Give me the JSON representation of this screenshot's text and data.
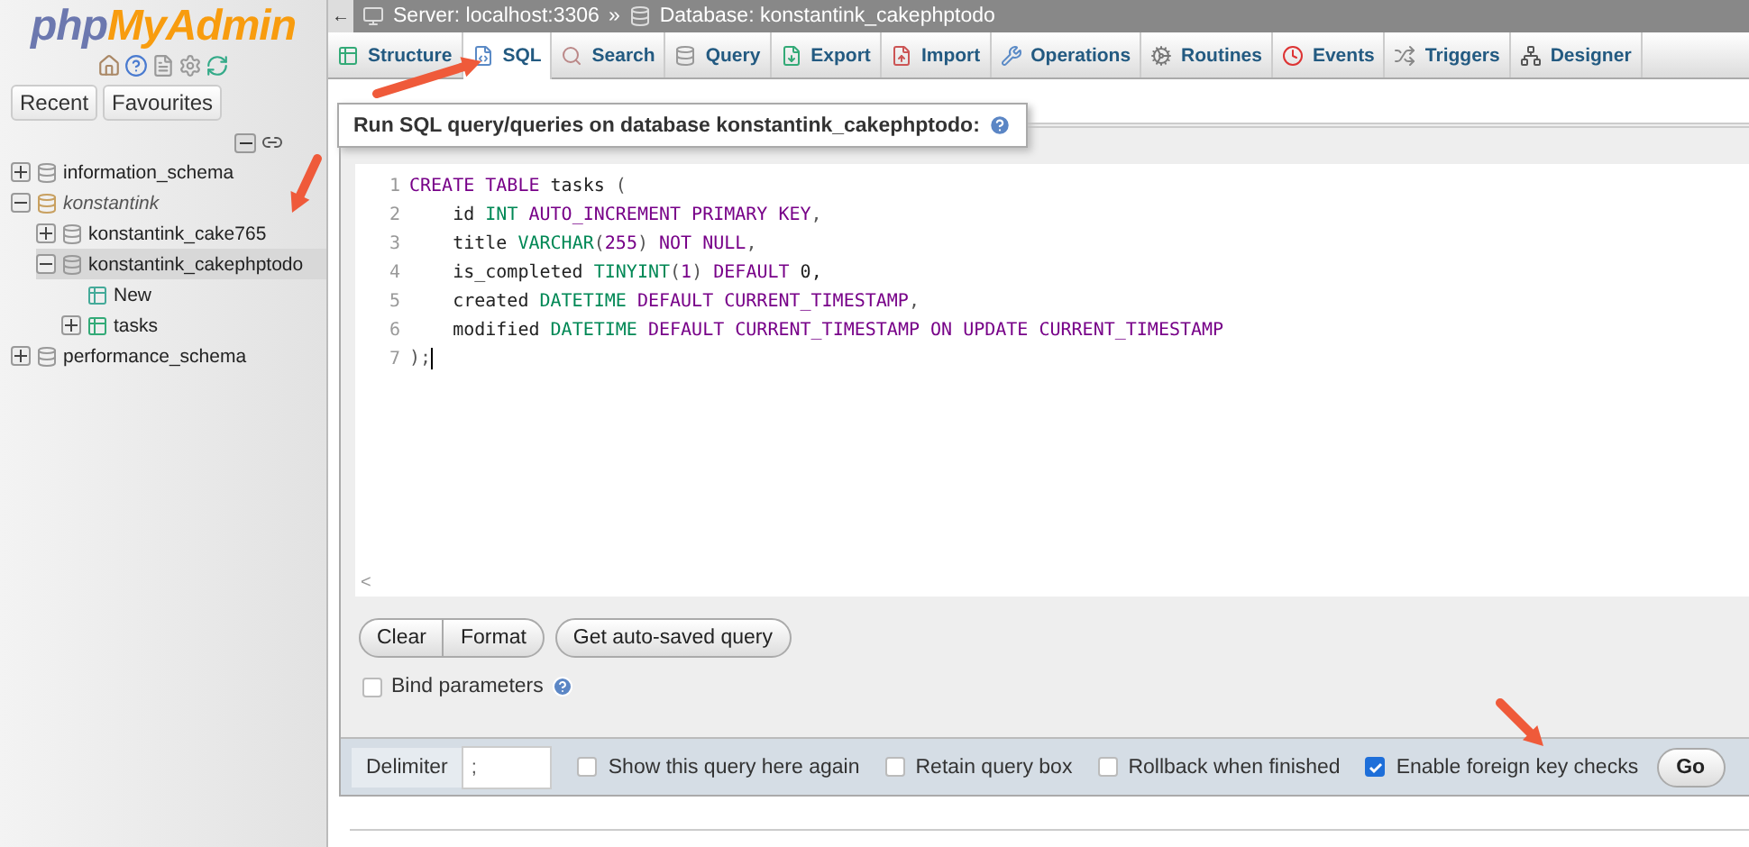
{
  "sidebar": {
    "logo": {
      "prefix": "php",
      "suffix": "MyAdmin"
    },
    "buttons": [
      "Recent",
      "Favourites"
    ],
    "tree": [
      {
        "label": "information_schema",
        "kind": "db",
        "expanded": false,
        "selected": false
      },
      {
        "label": "konstantink",
        "kind": "group",
        "expanded": true,
        "selected": false,
        "children": [
          {
            "label": "konstantink_cake765",
            "kind": "db",
            "expanded": false,
            "selected": false
          },
          {
            "label": "konstantink_cakephptodo",
            "kind": "db",
            "expanded": true,
            "selected": true,
            "children": [
              {
                "label": "New",
                "kind": "new",
                "selected": false
              },
              {
                "label": "tasks",
                "kind": "table",
                "expanded": false,
                "selected": false
              }
            ]
          }
        ]
      },
      {
        "label": "performance_schema",
        "kind": "db",
        "expanded": false,
        "selected": false
      }
    ]
  },
  "breadcrumb": {
    "back": "←",
    "server": "Server: localhost:3306",
    "separator": "»",
    "database": "Database: konstantink_cakephptodo"
  },
  "tabs": [
    {
      "label": "Structure",
      "kind": "structure",
      "selected": false
    },
    {
      "label": "SQL",
      "kind": "sql",
      "selected": true
    },
    {
      "label": "Search",
      "kind": "search",
      "selected": false
    },
    {
      "label": "Query",
      "kind": "query",
      "selected": false
    },
    {
      "label": "Export",
      "kind": "export",
      "selected": false
    },
    {
      "label": "Import",
      "kind": "import",
      "selected": false
    },
    {
      "label": "Operations",
      "kind": "operations",
      "selected": false
    },
    {
      "label": "Routines",
      "kind": "routines",
      "selected": false
    },
    {
      "label": "Events",
      "kind": "events",
      "selected": false
    },
    {
      "label": "Triggers",
      "kind": "triggers",
      "selected": false
    },
    {
      "label": "Designer",
      "kind": "designer",
      "selected": false
    }
  ],
  "panel_title": "Run SQL query/queries on database konstantink_cakephptodo:",
  "editor": {
    "lines": [
      {
        "number": "1",
        "tokens": [
          {
            "text": "CREATE TABLE",
            "kind": "keyword"
          },
          {
            "text": " tasks ",
            "kind": "plain"
          },
          {
            "text": "(",
            "kind": "punct"
          }
        ]
      },
      {
        "number": "2",
        "tokens": [
          {
            "text": "    id ",
            "kind": "plain"
          },
          {
            "text": "INT",
            "kind": "type"
          },
          {
            "text": " AUTO_INCREMENT PRIMARY KEY",
            "kind": "keyword"
          },
          {
            "text": ",",
            "kind": "punct"
          }
        ]
      },
      {
        "number": "3",
        "tokens": [
          {
            "text": "    title ",
            "kind": "plain"
          },
          {
            "text": "VARCHAR",
            "kind": "type"
          },
          {
            "text": "(",
            "kind": "punct"
          },
          {
            "text": "255",
            "kind": "keyword"
          },
          {
            "text": ")",
            "kind": "punct"
          },
          {
            "text": " NOT NULL",
            "kind": "keyword"
          },
          {
            "text": ",",
            "kind": "punct"
          }
        ]
      },
      {
        "number": "4",
        "tokens": [
          {
            "text": "    is_completed ",
            "kind": "plain"
          },
          {
            "text": "TINYINT",
            "kind": "type"
          },
          {
            "text": "(",
            "kind": "punct"
          },
          {
            "text": "1",
            "kind": "keyword"
          },
          {
            "text": ")",
            "kind": "punct"
          },
          {
            "text": " DEFAULT",
            "kind": "keyword"
          },
          {
            "text": " 0,",
            "kind": "plain"
          }
        ]
      },
      {
        "number": "5",
        "tokens": [
          {
            "text": "    created ",
            "kind": "plain"
          },
          {
            "text": "DATETIME",
            "kind": "type"
          },
          {
            "text": " DEFAULT CURRENT_TIMESTAMP",
            "kind": "keyword"
          },
          {
            "text": ",",
            "kind": "punct"
          }
        ]
      },
      {
        "number": "6",
        "tokens": [
          {
            "text": "    modified ",
            "kind": "plain"
          },
          {
            "text": "DATETIME",
            "kind": "type"
          },
          {
            "text": " DEFAULT CURRENT_TIMESTAMP ON UPDATE CURRENT_TIMESTAMP",
            "kind": "keyword"
          }
        ]
      },
      {
        "number": "7",
        "tokens": [
          {
            "text": ");",
            "kind": "punct"
          }
        ]
      }
    ],
    "scroll_left": "<"
  },
  "actions": [
    "Clear",
    "Format",
    "Get auto-saved query"
  ],
  "bind_parameters": {
    "label": "Bind parameters",
    "checked": false
  },
  "footer": {
    "delimiter_label": "Delimiter",
    "delimiter_value": ";",
    "options": [
      {
        "label": "Show this query here again",
        "checked": false
      },
      {
        "label": "Retain query box",
        "checked": false
      },
      {
        "label": "Rollback when finished",
        "checked": false
      },
      {
        "label": "Enable foreign key checks",
        "checked": true
      }
    ],
    "go": "Go"
  }
}
